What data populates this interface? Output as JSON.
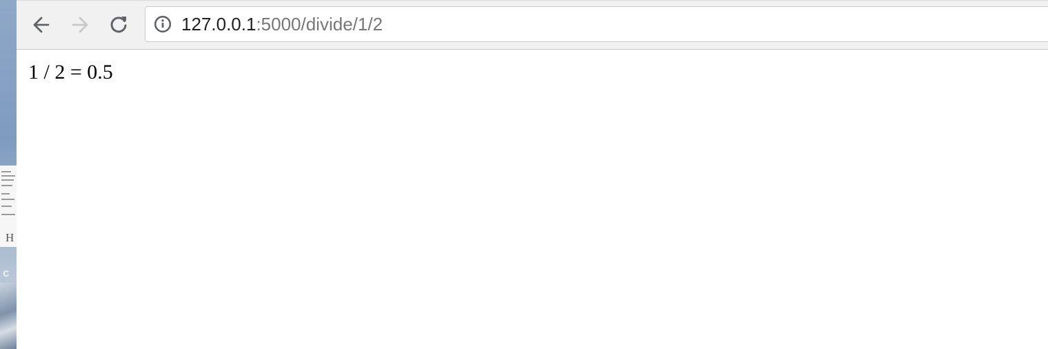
{
  "browser": {
    "back_icon": "arrow-left-icon",
    "forward_icon": "arrow-right-icon",
    "reload_icon": "reload-icon",
    "info_icon": "info-icon",
    "url_host": "127.0.0.1",
    "url_path": ":5000/divide/1/2",
    "colors": {
      "toolbar": "#f1f1f1",
      "host_text": "#202124",
      "path_text": "#777777",
      "disabled_icon": "#c8c8c8",
      "active_icon": "#5f6368"
    }
  },
  "page": {
    "result_text": "1 / 2 = 0.5"
  }
}
